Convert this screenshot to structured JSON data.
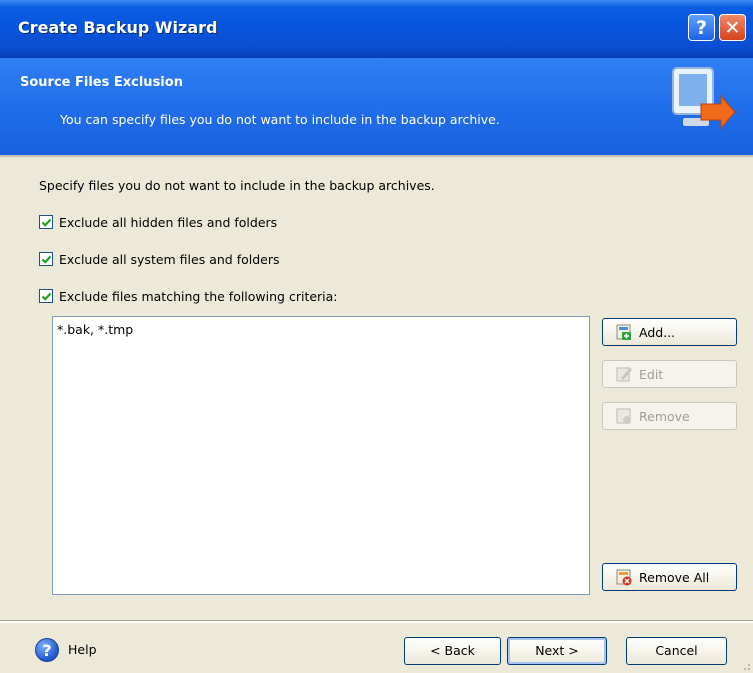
{
  "window": {
    "title": "Create Backup Wizard",
    "help_glyph": "?",
    "close_glyph": "✕"
  },
  "header": {
    "title": "Source Files Exclusion",
    "subtitle": "You can specify files you do not want to include in the backup archive."
  },
  "content": {
    "intro": "Specify files you do not want to include in the backup archives.",
    "checkboxes": [
      {
        "label": "Exclude all hidden files and folders",
        "checked": true
      },
      {
        "label": "Exclude all system files and folders",
        "checked": true
      },
      {
        "label": "Exclude files matching the following criteria:",
        "checked": true
      }
    ],
    "criteria_list": [
      "*.bak, *.tmp"
    ]
  },
  "side_buttons": {
    "add": "Add...",
    "edit": "Edit",
    "remove": "Remove",
    "remove_all": "Remove All"
  },
  "footer": {
    "help": "Help",
    "back": "< Back",
    "next": "Next >",
    "cancel": "Cancel"
  },
  "colors": {
    "titlebar": "#0a5de0",
    "header": "#1f6be8",
    "body": "#ece9d8"
  }
}
